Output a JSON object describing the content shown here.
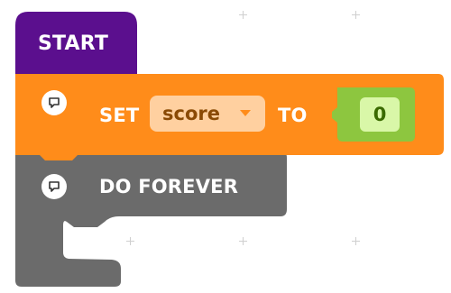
{
  "blocks": {
    "start": {
      "label": "START",
      "color": "#5b0f8e"
    },
    "set": {
      "set_label": "SET",
      "variable": "score",
      "to_label": "TO",
      "value": "0",
      "color": "#ff8c1a",
      "value_block_color": "#8dc63f"
    },
    "forever": {
      "label": "DO FOREVER",
      "color": "#6b6b6b"
    }
  },
  "icons": {
    "comment": "comment-icon",
    "dropdown": "caret-down-icon"
  }
}
